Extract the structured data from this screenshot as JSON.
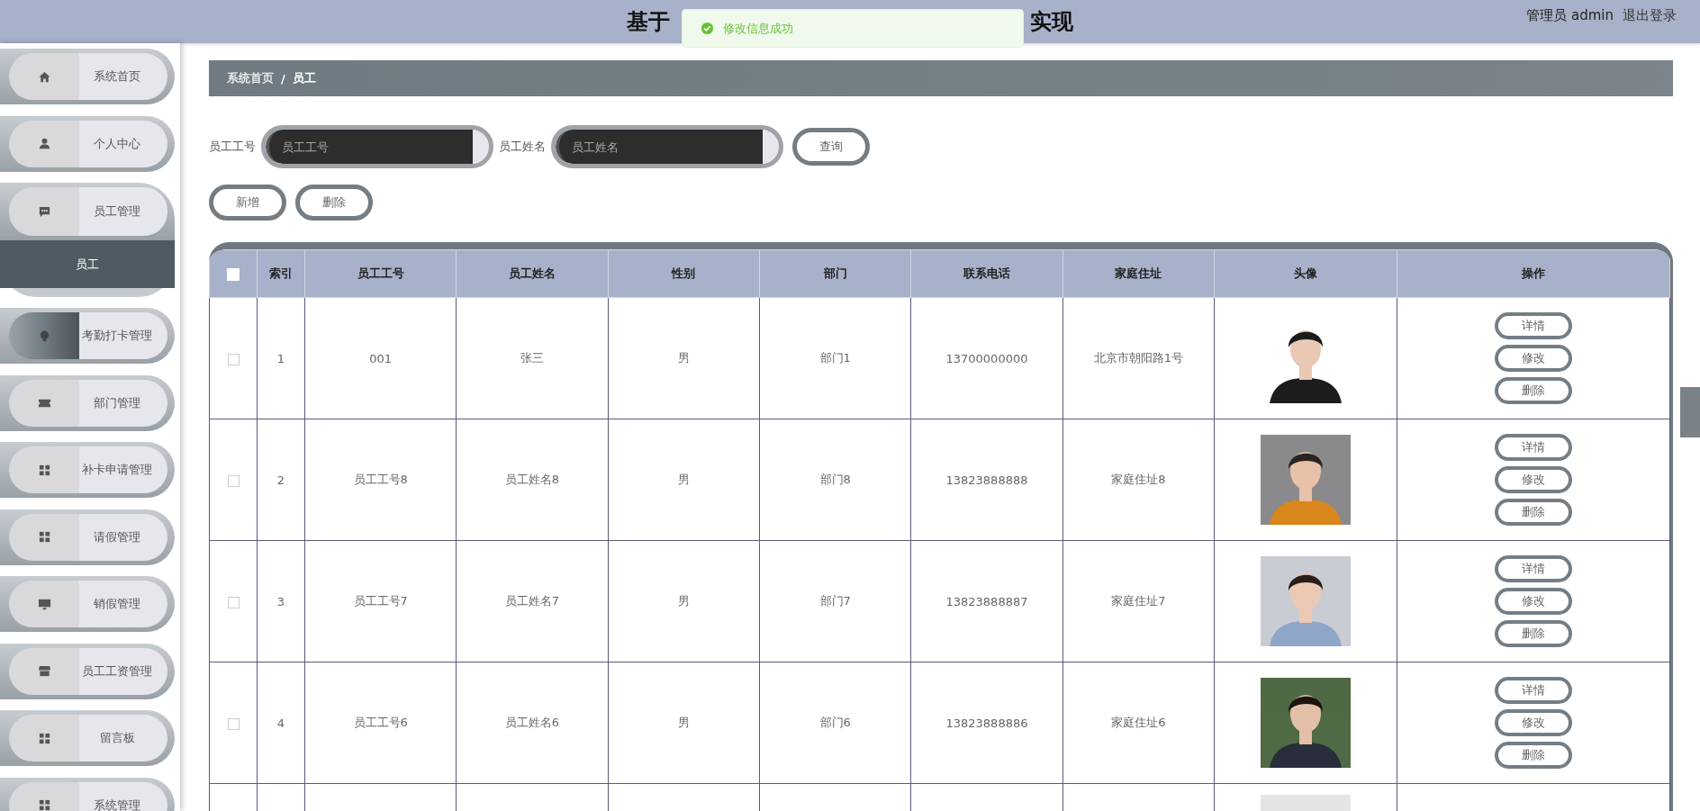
{
  "header": {
    "title_left": "基于",
    "title_right": "实现",
    "user": "管理员 admin",
    "logout": "退出登录"
  },
  "toast": {
    "message": "修改信息成功"
  },
  "sidebar": {
    "items": [
      {
        "label": "系统首页",
        "hovered": false,
        "expanded": false
      },
      {
        "label": "个人中心",
        "hovered": false,
        "expanded": false
      },
      {
        "label": "员工管理",
        "hovered": false,
        "expanded": true,
        "children": [
          {
            "label": "员工",
            "selected": true
          }
        ]
      },
      {
        "label": "考勤打卡管理",
        "hovered": true,
        "expanded": false
      },
      {
        "label": "部门管理",
        "hovered": false,
        "expanded": false
      },
      {
        "label": "补卡申请管理",
        "hovered": false,
        "expanded": false
      },
      {
        "label": "请假管理",
        "hovered": false,
        "expanded": false
      },
      {
        "label": "销假管理",
        "hovered": false,
        "expanded": false
      },
      {
        "label": "员工工资管理",
        "hovered": false,
        "expanded": false
      },
      {
        "label": "留言板",
        "hovered": false,
        "expanded": false
      },
      {
        "label": "系统管理",
        "hovered": false,
        "expanded": false
      }
    ]
  },
  "breadcrumb": [
    "系统首页",
    "/",
    "员工"
  ],
  "search": {
    "fields": [
      {
        "label": "员工工号",
        "placeholder": "员工工号"
      },
      {
        "label": "员工姓名",
        "placeholder": "员工姓名"
      }
    ],
    "button": "查询"
  },
  "actions": [
    "新增",
    "删除"
  ],
  "table": {
    "columns": [
      "索引",
      "员工工号",
      "员工姓名",
      "性别",
      "部门",
      "联系电话",
      "家庭住址",
      "头像",
      "操作"
    ],
    "header_checked": false,
    "rows": [
      {
        "checked": false,
        "cells": [
          "1",
          "001",
          "张三",
          "男",
          "部门1",
          "13700000000",
          "北京市朝阳路1号"
        ],
        "photo": {
          "kind": "picture"
        },
        "buttons": [
          "详情",
          "修改",
          "删除"
        ]
      },
      {
        "checked": false,
        "cells": [
          "2",
          "员工工号8",
          "员工姓名8",
          "男",
          "部门8",
          "13823888888",
          "家庭住址8"
        ],
        "photo": {
          "kind": "picture"
        },
        "buttons": [
          "详情",
          "修改",
          "删除"
        ]
      },
      {
        "checked": false,
        "cells": [
          "3",
          "员工工号7",
          "员工姓名7",
          "男",
          "部门7",
          "13823888887",
          "家庭住址7"
        ],
        "photo": {
          "kind": "picture"
        },
        "buttons": [
          "详情",
          "修改",
          "删除"
        ]
      },
      {
        "checked": false,
        "cells": [
          "4",
          "员工工号6",
          "员工姓名6",
          "男",
          "部门6",
          "13823888886",
          "家庭住址6"
        ],
        "photo": {
          "kind": "picture"
        },
        "buttons": [
          "详情",
          "修改",
          "删除"
        ]
      }
    ]
  }
}
